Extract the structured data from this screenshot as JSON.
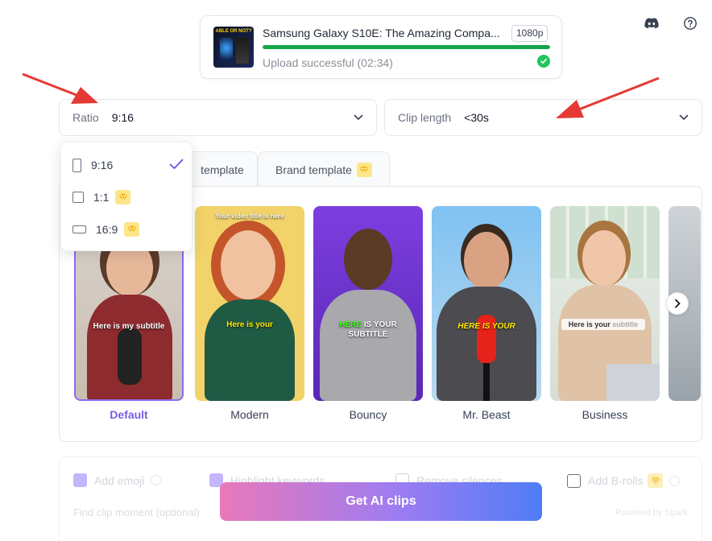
{
  "upload": {
    "thumbnail_text": "ABLE OR NOT?",
    "title": "Samsung Galaxy S10E: The Amazing Compa...",
    "resolution": "1080p",
    "progress_percent": 100,
    "status": "Upload successful (02:34)"
  },
  "ratio_select": {
    "label": "Ratio",
    "value": "9:16"
  },
  "clip_select": {
    "label": "Clip length",
    "value": "<30s"
  },
  "ratio_dropdown": {
    "options": [
      {
        "label": "9:16",
        "selected": true,
        "premium": false
      },
      {
        "label": "1:1",
        "selected": false,
        "premium": true
      },
      {
        "label": "16:9",
        "selected": false,
        "premium": true
      }
    ]
  },
  "tabs": [
    {
      "label": "template"
    },
    {
      "label": "Brand template",
      "premium": true
    }
  ],
  "templates": [
    {
      "name": "Default",
      "subtitle": "Here is my subtitle",
      "active": true
    },
    {
      "name": "Modern",
      "subtitle": "Here is your",
      "top_caption": "Your video title is here"
    },
    {
      "name": "Bouncy",
      "subtitle_highlight": "HERE",
      "subtitle": "IS YOUR",
      "subtitle_line2": "SUBTITLE"
    },
    {
      "name": "Mr. Beast",
      "subtitle_highlight": "HERE",
      "subtitle": "IS YOUR"
    },
    {
      "name": "Business",
      "subtitle": "Here is your",
      "subtitle_faded": "subtitle"
    }
  ],
  "options": {
    "add_emoji": "Add emoji",
    "highlight_keywords": "Highlight keywords",
    "remove_silences": "Remove silences",
    "add_brolls": "Add B-rolls",
    "find_clip_moment": "Find clip moment (optional)",
    "powered_by": "Powered by Spark"
  },
  "cta_label": "Get AI clips",
  "colors": {
    "accent": "#7c5ce6",
    "progress": "#16a34a",
    "success": "#22c55e",
    "gem": "#fde68a",
    "annotation_arrow": "#e53935"
  }
}
